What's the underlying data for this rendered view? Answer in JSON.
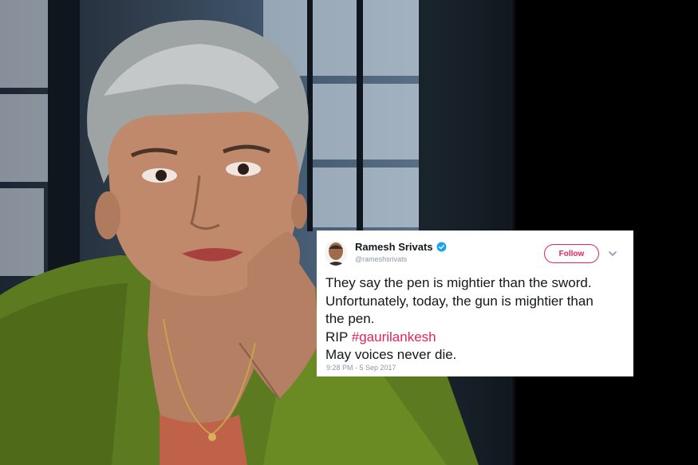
{
  "tweet": {
    "author_name": "Ramesh Srivats",
    "author_handle": "@rameshsrivats",
    "follow_label": "Follow",
    "lines": [
      "They say the pen is mightier than the sword.",
      "Unfortunately, today, the gun is mightier than",
      "the pen."
    ],
    "rip_prefix": "RIP ",
    "hashtag": "#gaurilankesh",
    "last_line": "May voices never die.",
    "timestamp": "9:28 PM - 5 Sep 2017",
    "colors": {
      "accent": "#e0245e",
      "verified": "#1da1f2",
      "text": "#14171a",
      "muted": "#8a99a6"
    },
    "icons": [
      "verified-badge-icon",
      "chevron-down-icon"
    ]
  }
}
